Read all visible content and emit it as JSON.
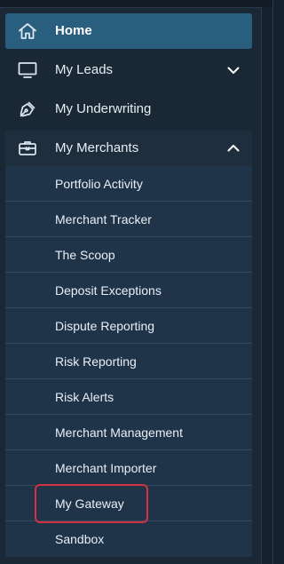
{
  "sidebar": {
    "items": [
      {
        "label": "Home",
        "icon": "home-icon",
        "active": true
      },
      {
        "label": "My Leads",
        "icon": "monitor-icon",
        "expandable": true,
        "expanded": false
      },
      {
        "label": "My Underwriting",
        "icon": "pen-nib-icon",
        "active": false
      },
      {
        "label": "My Merchants",
        "icon": "briefcase-icon",
        "expandable": true,
        "expanded": true
      }
    ],
    "merchants_submenu": [
      "Portfolio Activity",
      "Merchant Tracker",
      "The Scoop",
      "Deposit Exceptions",
      "Dispute Reporting",
      "Risk Reporting",
      "Risk Alerts",
      "Merchant Management",
      "Merchant Importer",
      "My Gateway",
      "Sandbox"
    ],
    "highlighted_item": "My Gateway"
  },
  "colors": {
    "sidebar_bg": "#1a2735",
    "active_bg": "#2a5e7f",
    "submenu_bg": "#203449",
    "divider": "#34495e",
    "highlight": "#d1323f",
    "text": "#e7edf3"
  }
}
